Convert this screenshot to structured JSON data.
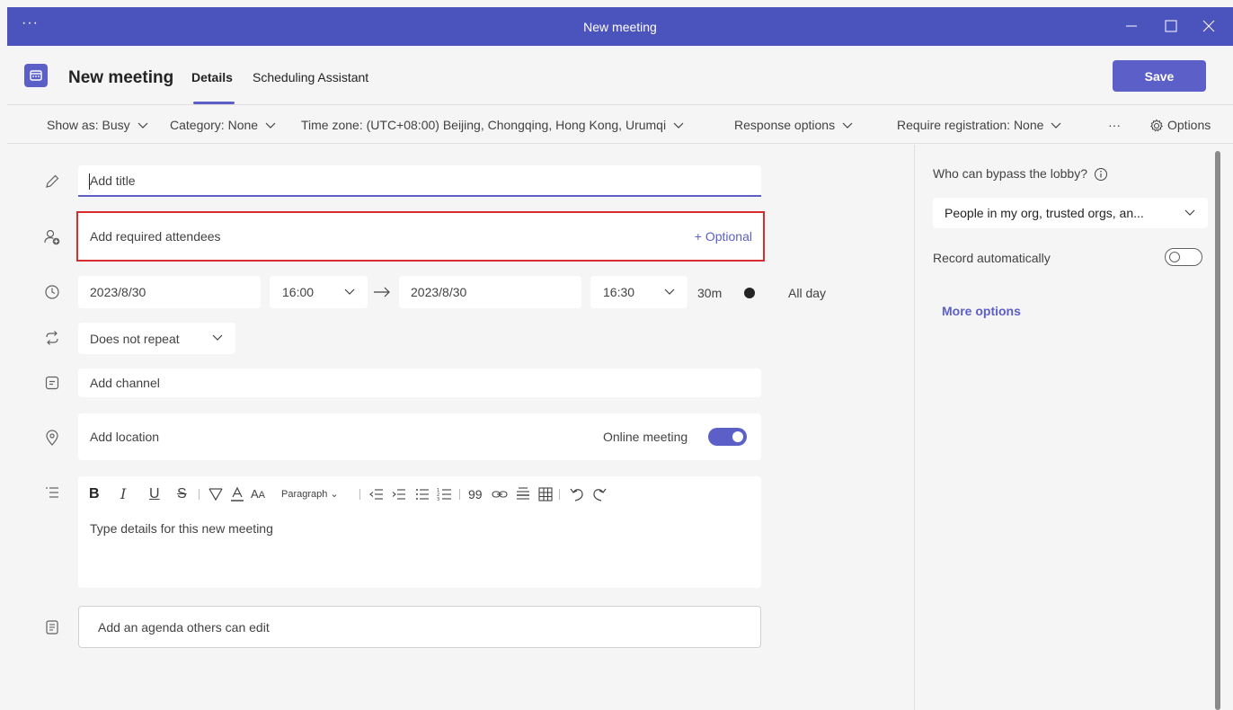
{
  "window": {
    "title": "New meeting",
    "menu_icon": "more-dots-icon"
  },
  "header": {
    "title": "New meeting",
    "tabs": [
      {
        "label": "Details",
        "active": true
      },
      {
        "label": "Scheduling Assistant",
        "active": false
      }
    ],
    "save_label": "Save"
  },
  "options_bar": {
    "show_as": "Show as: Busy",
    "category": "Category: None",
    "time_zone": "Time zone: (UTC+08:00) Beijing, Chongqing, Hong Kong, Urumqi",
    "response_options": "Response options",
    "require_registration": "Require registration: None",
    "more": "···",
    "options": "Options"
  },
  "form": {
    "title_placeholder": "Add title",
    "attendees_placeholder": "Add required attendees",
    "optional_link": "+ Optional",
    "start_date": "2023/8/30",
    "start_time": "16:00",
    "end_date": "2023/8/30",
    "end_time": "16:30",
    "duration": "30m",
    "all_day_label": "All day",
    "all_day_on": false,
    "repeat": "Does not repeat",
    "channel_placeholder": "Add channel",
    "location_placeholder": "Add location",
    "online_meeting_label": "Online meeting",
    "online_meeting_on": true,
    "editor": {
      "paragraph_label": "Paragraph",
      "quote_label": "99",
      "placeholder": "Type details for this new meeting"
    },
    "agenda_placeholder": "Add an agenda others can edit"
  },
  "side_panel": {
    "lobby_label": "Who can bypass the lobby?",
    "lobby_value": "People in my org, trusted orgs, an...",
    "record_label": "Record automatically",
    "record_on": false,
    "more_options": "More options"
  },
  "colors": {
    "titlebar": "#4b53bc",
    "accent": "#5b5fc7",
    "highlight_border": "#d92c2c"
  }
}
